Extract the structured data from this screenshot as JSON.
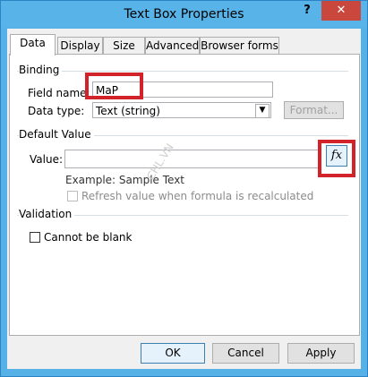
{
  "window": {
    "title": "Text Box Properties",
    "help_label": "?",
    "close_label": "✕"
  },
  "tabs": [
    {
      "label": "Data"
    },
    {
      "label": "Display"
    },
    {
      "label": "Size"
    },
    {
      "label": "Advanced"
    },
    {
      "label": "Browser forms"
    }
  ],
  "binding": {
    "group_label": "Binding",
    "field_name_label": "Field name:",
    "field_name_value": "MaP",
    "data_type_label": "Data type:",
    "data_type_value": "Text (string)",
    "format_button": "Format..."
  },
  "default_value": {
    "group_label": "Default Value",
    "value_label": "Value:",
    "value": "",
    "fx_label": "fx",
    "example": "Example: Sample Text",
    "refresh_label": "Refresh value when formula is recalculated"
  },
  "validation": {
    "group_label": "Validation",
    "cannot_be_blank_label": "Cannot be blank"
  },
  "footer": {
    "ok": "OK",
    "cancel": "Cancel",
    "apply": "Apply"
  },
  "watermark": "CHL.VN",
  "colors": {
    "highlight": "#d2232a",
    "titlebar": "#57b3e8",
    "close": "#c9473d"
  }
}
